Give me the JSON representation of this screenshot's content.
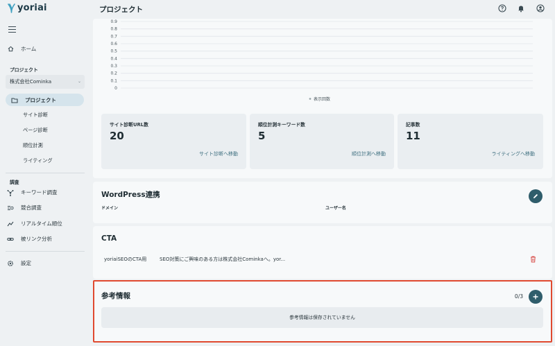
{
  "app": {
    "brand": "yoriai"
  },
  "header": {
    "title": "プロジェクト",
    "icons": [
      "help-icon",
      "bell-icon",
      "account-icon"
    ]
  },
  "sidebar": {
    "home": "ホーム",
    "project_section": "プロジェクト",
    "company": "株式会社Cominka",
    "project": "プロジェクト",
    "sub_items": [
      "サイト診断",
      "ページ診断",
      "順位計測",
      "ライティング"
    ],
    "research_section": "調査",
    "research_items": [
      "キーワード調査",
      "競合調査",
      "リアルタイム順位",
      "被リンク分析"
    ],
    "settings": "設定"
  },
  "chart_data": {
    "type": "line",
    "y_ticks": [
      "0.9",
      "0.8",
      "0.7",
      "0.6",
      "0.5",
      "0.4",
      "0.3",
      "0.2",
      "0.1",
      "0"
    ],
    "ylim": [
      0,
      0.9
    ],
    "series": [
      {
        "name": "表示回数",
        "values": []
      }
    ],
    "legend": "bottom"
  },
  "stats": [
    {
      "label": "サイト診断URL数",
      "value": "20",
      "link": "サイト診断へ移動"
    },
    {
      "label": "順位計測キーワード数",
      "value": "5",
      "link": "順位計測へ移動"
    },
    {
      "label": "記事数",
      "value": "11",
      "link": "ライティングへ移動"
    }
  ],
  "wordpress": {
    "title": "WordPress連携",
    "domain_label": "ドメイン",
    "user_label": "ユーザー名"
  },
  "cta": {
    "title": "CTA",
    "name": "yoriaiSEOのCTA用",
    "text": "SEO対策にご興味のある方は株式会社Cominkaへ。yor..."
  },
  "reference": {
    "title": "参考情報",
    "count": "0/3",
    "empty": "参考情報は保存されていません"
  },
  "colors": {
    "accent": "#2f5d6b",
    "highlight": "#e0492f",
    "delete": "#d9534f"
  }
}
